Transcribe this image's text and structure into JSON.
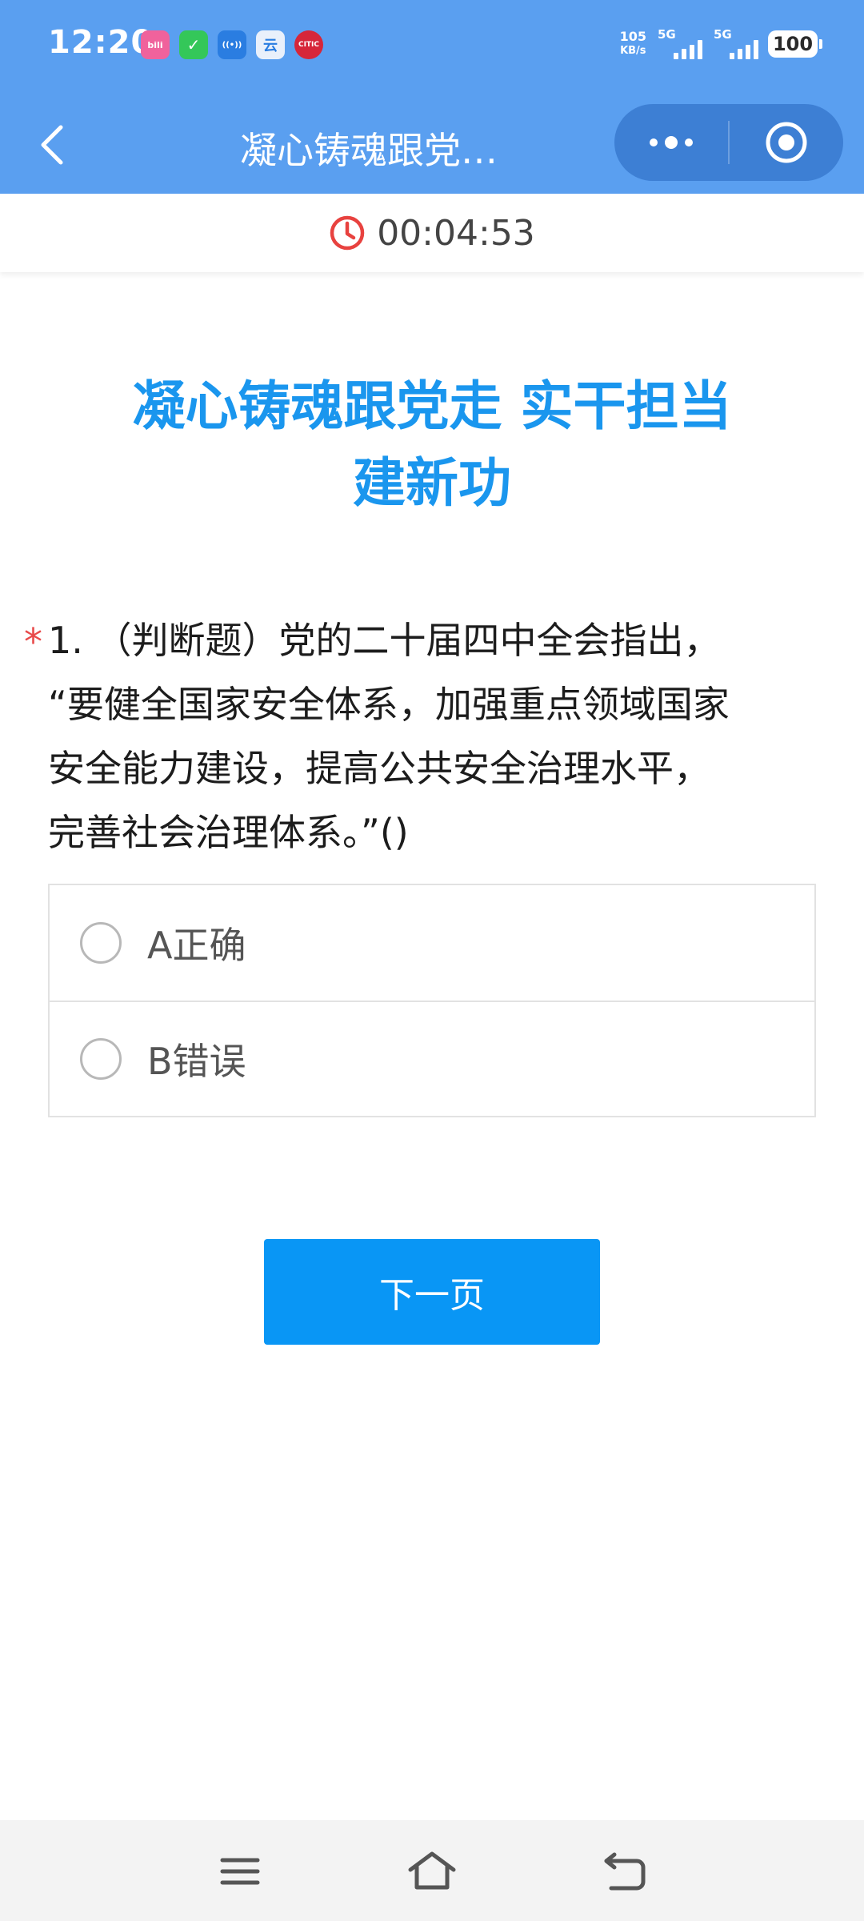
{
  "status_bar": {
    "time": "12:20",
    "app_icons": [
      {
        "name": "bilibili-icon",
        "label": "bili",
        "color": "#f0629c"
      },
      {
        "name": "wechat-pay-icon",
        "label": "✓",
        "color": "#34c759"
      },
      {
        "name": "hotspot-icon",
        "label": "((•))",
        "color": "#2a7de1"
      },
      {
        "name": "cloud-app-icon",
        "label": "云",
        "color": "#e9f0fb"
      },
      {
        "name": "citic-icon",
        "label": "CITIC",
        "color": "#d6263a"
      }
    ],
    "network_speed_value": "105",
    "network_speed_unit": "KB/s",
    "signal_1_label": "5G",
    "signal_2_label": "5G",
    "battery": "100"
  },
  "nav": {
    "title": "凝心铸魂跟党…"
  },
  "timer": {
    "value": "00:04:53",
    "icon_color": "#e8423f"
  },
  "survey": {
    "title_line1": "凝心铸魂跟党走 实干担当",
    "title_line2": "建新功",
    "title_color": "#1a96ee",
    "question": {
      "required_mark": "*",
      "lines": [
        "1. （判断题）党的二十届四中全会指出，",
        "“要健全国家安全体系，加强重点领域国家",
        "安全能力建设，提高公共安全治理水平，",
        "完善社会治理体系。”()"
      ],
      "options": [
        {
          "label": "A正确",
          "selected": false
        },
        {
          "label": "B错误",
          "selected": false
        }
      ]
    },
    "next_button_label": "下一页",
    "accent_color": "#0996f5"
  },
  "system_nav": {
    "icons": [
      "menu-icon",
      "home-icon",
      "back-icon"
    ]
  }
}
